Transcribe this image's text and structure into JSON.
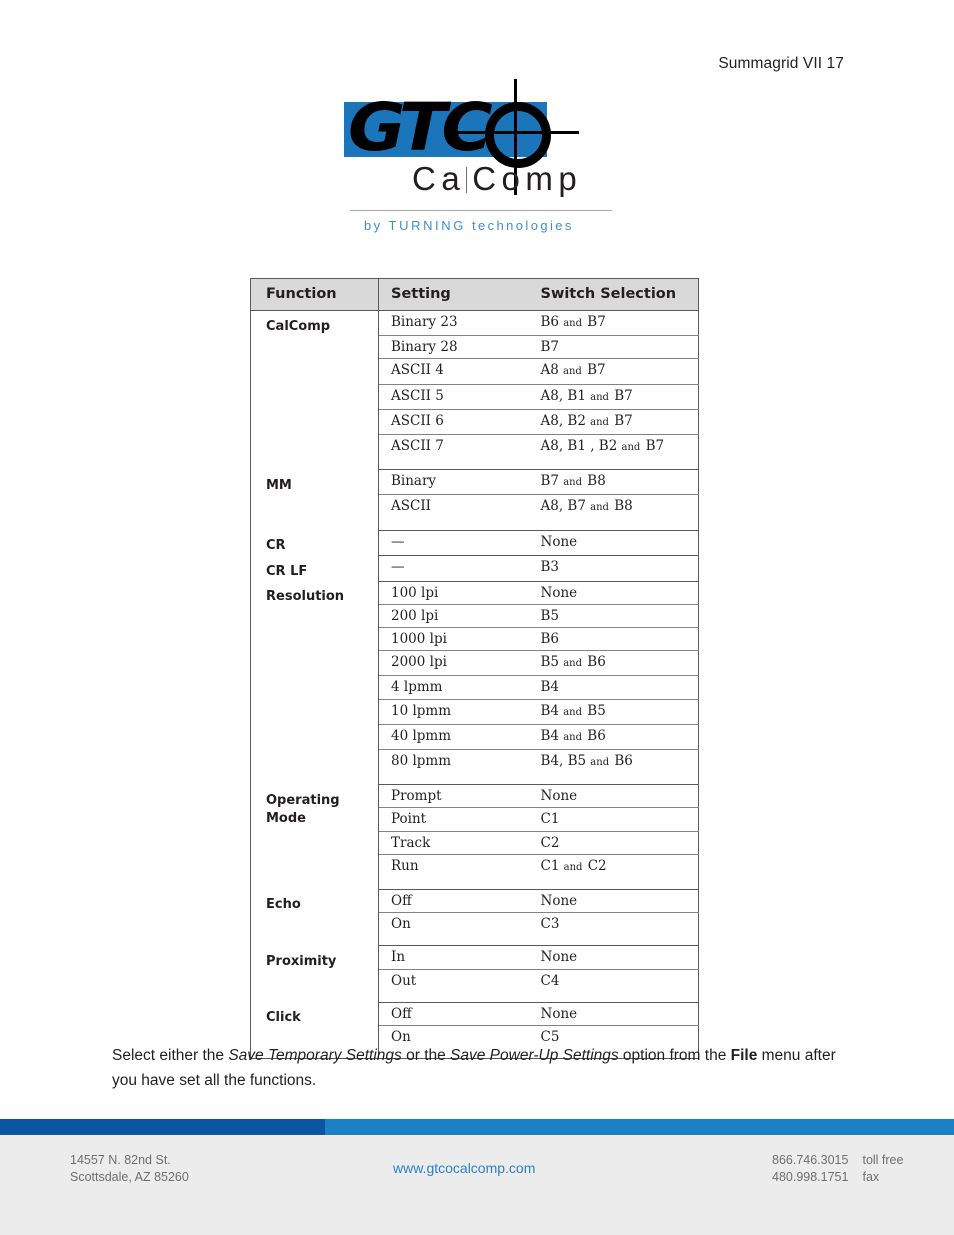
{
  "page_header": "Summagrid VII 17",
  "logo": {
    "wordmark": "GTC",
    "target_icon": "crosshair-target-icon",
    "brand_line": "Ca",
    "brand_line2": "Comp",
    "tagline_prefix": "by ",
    "tagline_brand": "TURNING",
    "tagline_suffix": " technologies",
    "blue": "#1b75bb",
    "tagline_color": "#3f8fce"
  },
  "table": {
    "headers": [
      "Function",
      "Setting",
      "Switch Selection"
    ],
    "groups": [
      {
        "function": "CalComp",
        "rows": [
          {
            "setting": "Binary 23",
            "switch_parts": [
              "B6",
              "and",
              "B7"
            ]
          },
          {
            "setting": "Binary 28",
            "switch_parts": [
              "B7"
            ]
          },
          {
            "setting": "ASCII 4",
            "switch_parts": [
              "A8",
              "and",
              "B7"
            ]
          },
          {
            "setting": "ASCII 5",
            "switch_parts": [
              "A8, B1",
              "and",
              "B7"
            ]
          },
          {
            "setting": "ASCII 6",
            "switch_parts": [
              "A8, B2",
              "and",
              "B7"
            ]
          },
          {
            "setting": "ASCII 7",
            "switch_parts": [
              "A8, B1 , B2",
              "and",
              "B7"
            ]
          }
        ]
      },
      {
        "function": "MM",
        "rows": [
          {
            "setting": "Binary",
            "switch_parts": [
              "B7",
              "and",
              "B8"
            ]
          },
          {
            "setting": "ASCII",
            "switch_parts": [
              "A8, B7",
              "and",
              "B8"
            ]
          }
        ]
      },
      {
        "function": "CR",
        "rows": [
          {
            "setting": "—",
            "switch_parts": [
              "None"
            ]
          }
        ]
      },
      {
        "function": "CR LF",
        "rows": [
          {
            "setting": "—",
            "switch_parts": [
              "B3"
            ]
          }
        ]
      },
      {
        "function": "Resolution",
        "rows": [
          {
            "setting": "100 lpi",
            "switch_parts": [
              "None"
            ]
          },
          {
            "setting": "200 lpi",
            "switch_parts": [
              "B5"
            ]
          },
          {
            "setting": "1000 lpi",
            "switch_parts": [
              "B6"
            ]
          },
          {
            "setting": "2000 lpi",
            "switch_parts": [
              "B5",
              "and",
              "B6"
            ]
          },
          {
            "setting": "4 lpmm",
            "switch_parts": [
              "B4"
            ]
          },
          {
            "setting": "10 lpmm",
            "switch_parts": [
              "B4",
              "and",
              "B5"
            ]
          },
          {
            "setting": "40 lpmm",
            "switch_parts": [
              "B4",
              "and",
              "B6"
            ]
          },
          {
            "setting": "80 lpmm",
            "switch_parts": [
              "B4, B5",
              "and",
              "B6"
            ]
          }
        ]
      },
      {
        "function": "Operating Mode",
        "rows": [
          {
            "setting": "Prompt",
            "switch_parts": [
              "None"
            ]
          },
          {
            "setting": "Point",
            "switch_parts": [
              "C1"
            ]
          },
          {
            "setting": "Track",
            "switch_parts": [
              "C2"
            ]
          },
          {
            "setting": "Run",
            "switch_parts": [
              "C1",
              "and",
              "C2"
            ]
          }
        ]
      },
      {
        "function": "Echo",
        "rows": [
          {
            "setting": "Off",
            "switch_parts": [
              "None"
            ]
          },
          {
            "setting": "On",
            "switch_parts": [
              "C3"
            ]
          }
        ]
      },
      {
        "function": "Proximity",
        "rows": [
          {
            "setting": "In",
            "switch_parts": [
              "None"
            ]
          },
          {
            "setting": "Out",
            "switch_parts": [
              "C4"
            ]
          }
        ]
      },
      {
        "function": "Click",
        "rows": [
          {
            "setting": "Off",
            "switch_parts": [
              "None"
            ]
          },
          {
            "setting": "On",
            "switch_parts": [
              "C5"
            ]
          }
        ]
      }
    ]
  },
  "body": {
    "seg1": "Select either the ",
    "em1": "Save Temporary Settings",
    "seg2": " or the ",
    "em2": "Save Power-Up Settings",
    "seg3": " option from the ",
    "strong1": "File",
    "seg4": " menu after you have set all the functions."
  },
  "footer": {
    "address_line1": "14557 N. 82nd St.",
    "address_line2": "Scottsdale, AZ 85260",
    "website": "www.gtcocalcomp.com",
    "phone_tollfree": "866.746.3015",
    "label_tollfree": "toll free",
    "phone_fax": "480.998.1751",
    "label_fax": "fax",
    "bar_dark": "#0b56a4",
    "bar_light": "#1b80c4"
  }
}
